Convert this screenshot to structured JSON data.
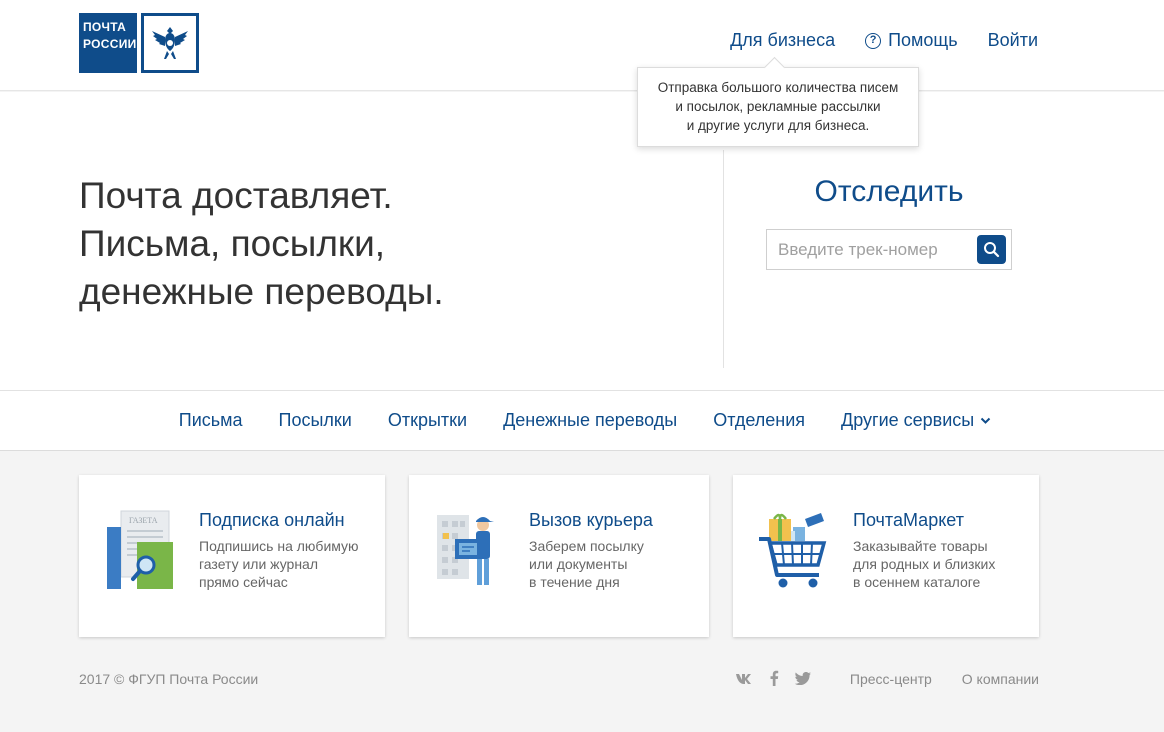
{
  "brand": {
    "logo_line1": "ПОЧТА",
    "logo_line2": "РОССИИ",
    "color": "#0f4c8a"
  },
  "topnav": {
    "business": "Для бизнеса",
    "help": "Помощь",
    "login": "Войти"
  },
  "tooltip": {
    "lines": [
      "Отправка большого количества писем",
      "и посылок, рекламные рассылки",
      "и другие услуги для бизнеса."
    ]
  },
  "hero": {
    "lines": [
      "Почта доставляет.",
      "Письма, посылки,",
      "денежные переводы."
    ]
  },
  "track": {
    "title": "Отследить",
    "placeholder": "Введите трек-номер"
  },
  "nav": {
    "items": [
      "Письма",
      "Посылки",
      "Открытки",
      "Денежные переводы",
      "Отделения",
      "Другие сервисы"
    ]
  },
  "cards": [
    {
      "title": "Подписка онлайн",
      "desc": [
        "Подпишись на любимую",
        "газету или журнал",
        "прямо сейчас"
      ],
      "newspaper_label": "ГАЗЕТА"
    },
    {
      "title": "Вызов курьера",
      "desc": [
        "Заберем посылку",
        "или документы",
        "в течение дня"
      ]
    },
    {
      "title": "ПочтаМаркет",
      "desc": [
        "Заказывайте товары",
        "для родных и близких",
        "в осеннем каталоге"
      ]
    }
  ],
  "footer": {
    "copyright": "2017 © ФГУП Почта России",
    "social": [
      "vk-icon",
      "facebook-icon",
      "twitter-icon"
    ],
    "links": [
      "Пресс-центр",
      "О компании"
    ]
  }
}
